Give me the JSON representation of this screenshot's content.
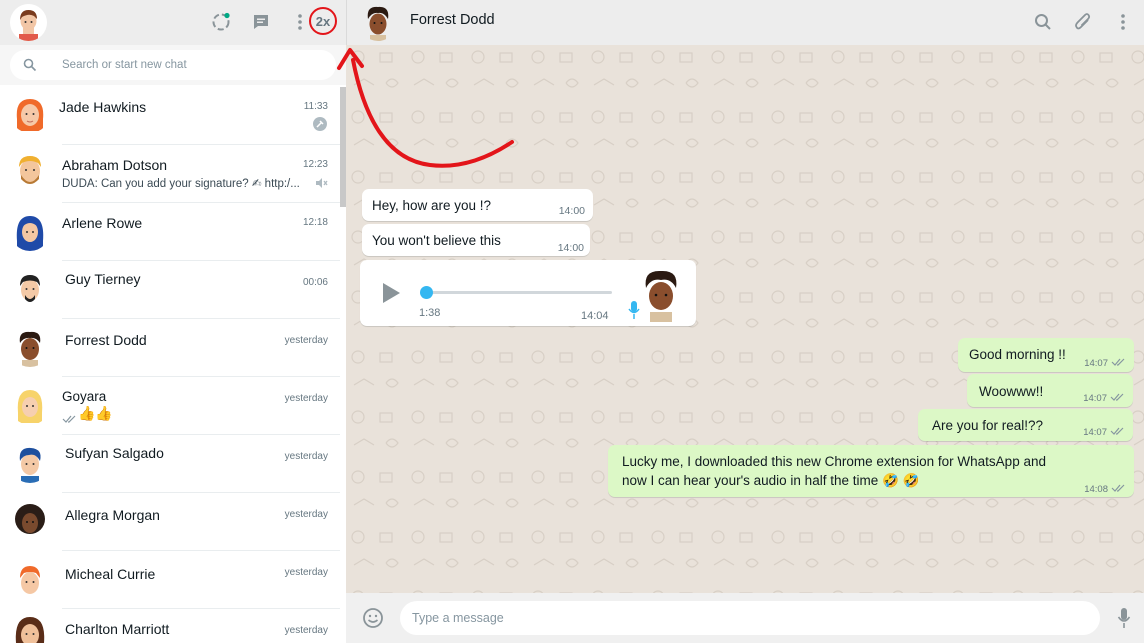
{
  "sidebar": {
    "speed_label": "2x",
    "search_placeholder": "Search or start new chat",
    "chats": [
      {
        "name": "Jade Hawkins",
        "time": "11:33",
        "preview": ""
      },
      {
        "name": "Abraham Dotson",
        "time": "12:23",
        "preview": "DUDA: Can you add your signature? ✍ http:/..."
      },
      {
        "name": "Arlene Rowe",
        "time": "12:18",
        "preview": ""
      },
      {
        "name": "Guy Tierney",
        "time": "00:06",
        "preview": ""
      },
      {
        "name": "Forrest Dodd",
        "time": "yesterday",
        "preview": ""
      },
      {
        "name": "Goyara",
        "time": "yesterday",
        "preview": "👍👍"
      },
      {
        "name": "Sufyan Salgado",
        "time": "yesterday",
        "preview": ""
      },
      {
        "name": "Allegra Morgan",
        "time": "yesterday",
        "preview": ""
      },
      {
        "name": "Micheal Currie",
        "time": "yesterday",
        "preview": ""
      },
      {
        "name": "Charlton Marriott",
        "time": "yesterday",
        "preview": ""
      }
    ]
  },
  "conversation": {
    "contact_name": "Forrest Dodd",
    "messages": [
      {
        "text": "Hey, how are you !?",
        "time": "14:00",
        "direction": "in"
      },
      {
        "text": "You won't believe this",
        "time": "14:00",
        "direction": "in"
      },
      {
        "type": "voice",
        "duration": "1:38",
        "time": "14:04",
        "direction": "in"
      },
      {
        "text": "Good morning !!",
        "time": "14:07",
        "direction": "out"
      },
      {
        "text": "Woowww!!",
        "time": "14:07",
        "direction": "out"
      },
      {
        "text": "Are you for real!??",
        "time": "14:07",
        "direction": "out"
      },
      {
        "text_line1": "Lucky me, I downloaded this new Chrome extension for WhatsApp and",
        "text_line2": "now I can hear your's audio in half the time 🤣 🤣",
        "time": "14:08",
        "direction": "out"
      }
    ],
    "input_placeholder": "Type a message"
  },
  "colors": {
    "accent_red": "#e3151a",
    "outgoing_bubble": "#dcf8c6",
    "voice_progress": "#34b7f1"
  }
}
